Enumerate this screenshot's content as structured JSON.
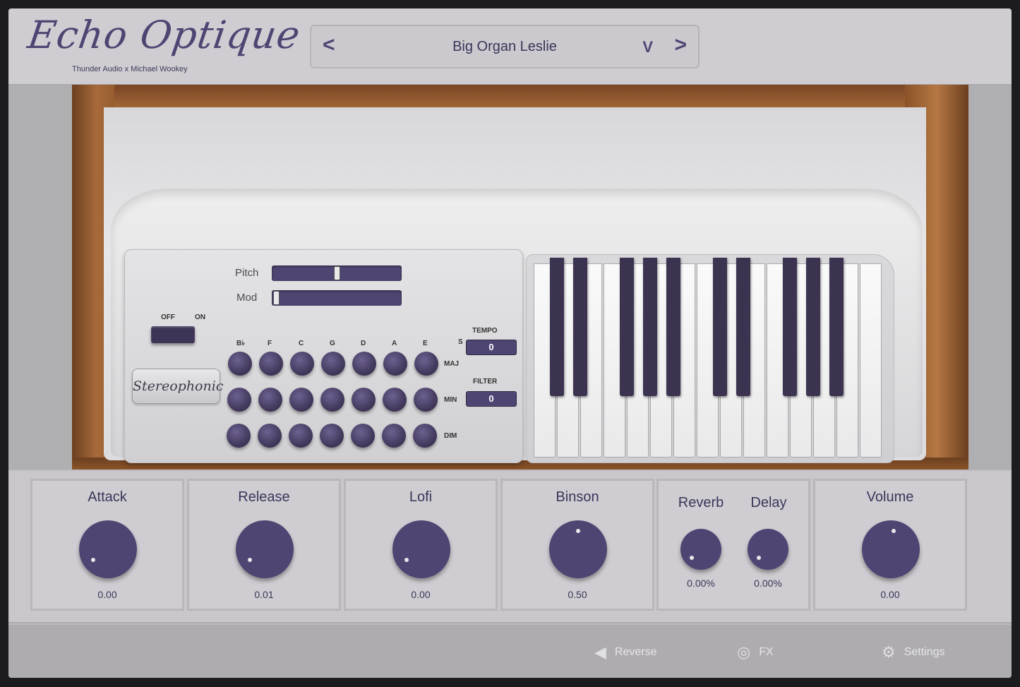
{
  "header": {
    "logo": "Echo Optique",
    "tagline": "Thunder Audio x Michael Wookey",
    "preset_name": "Big Organ Leslie",
    "prev_icon": "chevron-left-icon",
    "next_icon": "chevron-right-icon",
    "dropdown_icon": "chevron-down-icon"
  },
  "panel": {
    "pitch_label": "Pitch",
    "mod_label": "Mod",
    "pitch_value": 0.5,
    "mod_value": 0.0,
    "off_label": "OFF",
    "on_label": "ON",
    "badge": "Stereophonic",
    "chord_roots": [
      "B♭",
      "F",
      "C",
      "G",
      "D",
      "A",
      "E"
    ],
    "chord_types": [
      "MAJ",
      "MIN",
      "DIM"
    ],
    "tempo_label": "TEMPO",
    "tempo_unit": "S",
    "tempo_value": "0",
    "filter_label": "FILTER",
    "filter_value": "0"
  },
  "knobs": {
    "attack": {
      "label": "Attack",
      "value": "0.00"
    },
    "release": {
      "label": "Release",
      "value": "0.01"
    },
    "lofi": {
      "label": "Lofi",
      "value": "0.00"
    },
    "binson": {
      "label": "Binson",
      "value": "0.50"
    },
    "reverb": {
      "label": "Reverb",
      "value": "0.00%"
    },
    "delay": {
      "label": "Delay",
      "value": "0.00%"
    },
    "volume": {
      "label": "Volume",
      "value": "0.00"
    }
  },
  "footer": {
    "reverse_label": "Reverse",
    "fx_label": "FX",
    "settings_label": "Settings"
  },
  "colors": {
    "accent": "#4f4573",
    "panel": "#cfcdd1",
    "wood": "#a86a3a"
  }
}
